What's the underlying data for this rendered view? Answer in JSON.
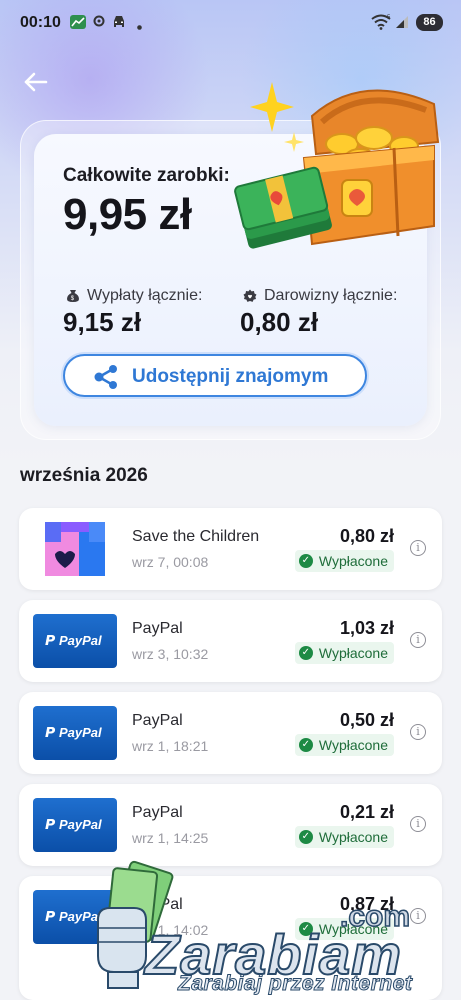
{
  "status_bar": {
    "time": "00:10",
    "battery": "86",
    "icons": [
      "chart-icon",
      "settings-icon",
      "car-icon",
      "dot-icon",
      "wifi-icon",
      "signal-icon"
    ]
  },
  "header": {
    "back_icon": "arrow-left-icon"
  },
  "summary": {
    "total_label": "Całkowite zarobki:",
    "total_value": "9,95 zł",
    "payouts_label": "Wypłaty łącznie:",
    "payouts_value": "9,15 zł",
    "donations_label": "Darowizny łącznie:",
    "donations_value": "0,80 zł",
    "share_label": "Udostępnij znajomym",
    "illustration": "treasure-chest-money"
  },
  "month_heading": "września 2026",
  "transactions": [
    {
      "name": "Save the Children",
      "date": "wrz 7, 00:08",
      "amount": "0,80 zł",
      "status": "Wypłacone",
      "logo": "save-the-children"
    },
    {
      "name": "PayPal",
      "date": "wrz 3, 10:32",
      "amount": "1,03 zł",
      "status": "Wypłacone",
      "logo": "paypal"
    },
    {
      "name": "PayPal",
      "date": "wrz 1, 18:21",
      "amount": "0,50 zł",
      "status": "Wypłacone",
      "logo": "paypal"
    },
    {
      "name": "PayPal",
      "date": "wrz 1, 14:25",
      "amount": "0,21 zł",
      "status": "Wypłacone",
      "logo": "paypal"
    },
    {
      "name": "PayPal",
      "date": "wrz 1, 14:02",
      "amount": "0,87 zł",
      "status": "Wypłacone",
      "logo": "paypal"
    }
  ],
  "paypal_logo_text": "PayPal",
  "watermark": {
    "domain": ".com",
    "name": "Zarabiam",
    "tagline": "Zarabiaj przez Internet"
  },
  "colors": {
    "accent": "#3e86e0",
    "status_green": "#1d8a44",
    "status_bg": "#eaf6ee"
  }
}
